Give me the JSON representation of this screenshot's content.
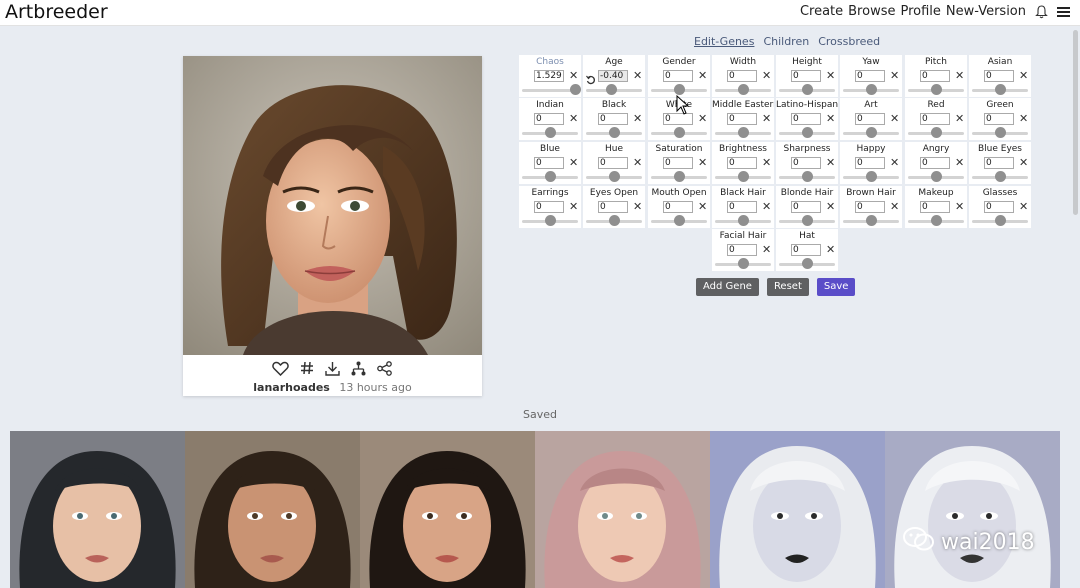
{
  "app": {
    "title": "Artbreeder"
  },
  "nav": {
    "items": [
      "Create",
      "Browse",
      "Profile",
      "New-Version"
    ],
    "icons": [
      "bell-icon",
      "menu-icon"
    ]
  },
  "tabs": [
    {
      "label": "Edit-Genes",
      "active": true
    },
    {
      "label": "Children",
      "active": false
    },
    {
      "label": "Crossbreed",
      "active": false
    }
  ],
  "genes": [
    {
      "label": "Chaos",
      "value": "1.529",
      "level": 0.95,
      "header": true
    },
    {
      "label": "Age",
      "value": "-0.40",
      "level": 0.45,
      "reset": true
    },
    {
      "label": "Gender",
      "value": "0",
      "level": 0.5
    },
    {
      "label": "Width",
      "value": "0",
      "level": 0.5
    },
    {
      "label": "Height",
      "value": "0",
      "level": 0.5
    },
    {
      "label": "Yaw",
      "value": "0",
      "level": 0.5
    },
    {
      "label": "Pitch",
      "value": "0",
      "level": 0.5
    },
    {
      "label": "Asian",
      "value": "0",
      "level": 0.5
    },
    {
      "label": "Indian",
      "value": "0",
      "level": 0.5
    },
    {
      "label": "Black",
      "value": "0",
      "level": 0.5
    },
    {
      "label": "White",
      "value": "0",
      "level": 0.5
    },
    {
      "label": "Middle Eastern",
      "value": "0",
      "level": 0.5
    },
    {
      "label": "Latino-Hispanic",
      "value": "0",
      "level": 0.5
    },
    {
      "label": "Art",
      "value": "0",
      "level": 0.5
    },
    {
      "label": "Red",
      "value": "0",
      "level": 0.5
    },
    {
      "label": "Green",
      "value": "0",
      "level": 0.5
    },
    {
      "label": "Blue",
      "value": "0",
      "level": 0.5
    },
    {
      "label": "Hue",
      "value": "0",
      "level": 0.5
    },
    {
      "label": "Saturation",
      "value": "0",
      "level": 0.5
    },
    {
      "label": "Brightness",
      "value": "0",
      "level": 0.5
    },
    {
      "label": "Sharpness",
      "value": "0",
      "level": 0.5
    },
    {
      "label": "Happy",
      "value": "0",
      "level": 0.5
    },
    {
      "label": "Angry",
      "value": "0",
      "level": 0.5
    },
    {
      "label": "Blue Eyes",
      "value": "0",
      "level": 0.5
    },
    {
      "label": "Earrings",
      "value": "0",
      "level": 0.5
    },
    {
      "label": "Eyes Open",
      "value": "0",
      "level": 0.5
    },
    {
      "label": "Mouth Open",
      "value": "0",
      "level": 0.5
    },
    {
      "label": "Black Hair",
      "value": "0",
      "level": 0.5
    },
    {
      "label": "Blonde Hair",
      "value": "0",
      "level": 0.5
    },
    {
      "label": "Brown Hair",
      "value": "0",
      "level": 0.5
    },
    {
      "label": "Makeup",
      "value": "0",
      "level": 0.5
    },
    {
      "label": "Glasses",
      "value": "0",
      "level": 0.5
    },
    {
      "label": "Facial Hair",
      "value": "0",
      "level": 0.5
    },
    {
      "label": "Hat",
      "value": "0",
      "level": 0.5
    }
  ],
  "buttons": {
    "add_gene": "Add Gene",
    "reset": "Reset",
    "save": "Save"
  },
  "card": {
    "user": "lanarhoades",
    "time": "13 hours ago",
    "icons": [
      "heart-icon",
      "hashtag-icon",
      "download-icon",
      "lineage-icon",
      "share-icon"
    ]
  },
  "saved": {
    "label": "Saved"
  },
  "watermark": {
    "text": "wai2018"
  },
  "colors": {
    "accent": "#5a4dc8",
    "button_gray": "#5f6062",
    "background": "#e8ecf2"
  }
}
